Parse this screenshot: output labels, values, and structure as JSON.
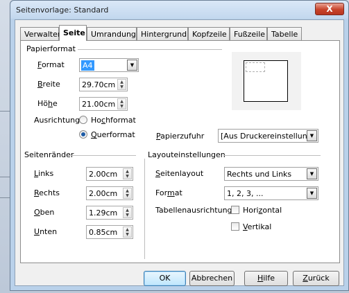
{
  "window": {
    "title": "Seitenvorlage: Standard",
    "close_glyph": "X"
  },
  "tabs": [
    "Verwalten",
    "Seite",
    "Umrandung",
    "Hintergrund",
    "Kopfzeile",
    "Fußzeile",
    "Tabelle"
  ],
  "active_tab": "Seite",
  "paper_format": {
    "title": "Papierformat",
    "format_label": "Format",
    "format_value": "A4",
    "width_label": "Breite",
    "width_value": "29.70cm",
    "height_label": "Höhe",
    "height_value": "21.00cm",
    "orientation_label": "Ausrichtung",
    "portrait_label": "Hochformat",
    "landscape_label": "Querformat",
    "orientation_selected": "Querformat",
    "paper_tray_label": "Papierzufuhr",
    "paper_tray_value": "[Aus Druckereinstellung]"
  },
  "margins": {
    "title": "Seitenränder",
    "left_label": "Links",
    "left_value": "2.00cm",
    "right_label": "Rechts",
    "right_value": "2.00cm",
    "top_label": "Oben",
    "top_value": "1.29cm",
    "bottom_label": "Unten",
    "bottom_value": "0.85cm"
  },
  "layout": {
    "title": "Layouteinstellungen",
    "page_layout_label": "Seitenlayout",
    "page_layout_value": "Rechts und Links",
    "format_label": "Format",
    "format_value": "1, 2, 3, ...",
    "table_alignment_label": "Tabellenausrichtung",
    "horizontal_label": "Horizontal",
    "vertical_label": "Vertikal"
  },
  "buttons": {
    "ok": "OK",
    "cancel": "Abbrechen",
    "help": "Hilfe",
    "back": "Zurück"
  },
  "icons": {
    "spin_up": "▲",
    "spin_down": "▼",
    "dropdown": "▼"
  },
  "colors": {
    "selection": "#3399ff",
    "title_bar": "#c2d7ee",
    "close_button": "#c7432a"
  }
}
